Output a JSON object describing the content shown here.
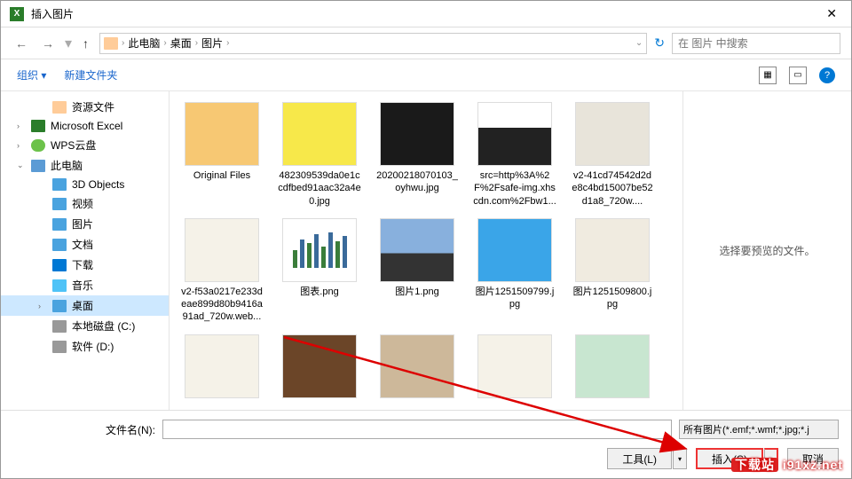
{
  "title": "插入图片",
  "nav": {
    "back": "←",
    "fwd": "→",
    "up": "↑",
    "crumbs": [
      "此电脑",
      "桌面",
      "图片"
    ],
    "refresh": "↻",
    "search_placeholder": "在 图片 中搜索"
  },
  "toolbar": {
    "organize": "组织 ▾",
    "new_folder": "新建文件夹"
  },
  "tree": [
    {
      "label": "资源文件",
      "indent": true,
      "icon": "folder"
    },
    {
      "label": "Microsoft Excel",
      "icon": "green",
      "caret": "›"
    },
    {
      "label": "WPS云盘",
      "icon": "cloud",
      "caret": "›"
    },
    {
      "label": "此电脑",
      "icon": "pc",
      "caret": "⌄"
    },
    {
      "label": "3D Objects",
      "indent": true,
      "icon": "blue"
    },
    {
      "label": "视频",
      "indent": true,
      "icon": "blue"
    },
    {
      "label": "图片",
      "indent": true,
      "icon": "blue"
    },
    {
      "label": "文档",
      "indent": true,
      "icon": "blue"
    },
    {
      "label": "下载",
      "indent": true,
      "icon": "dl"
    },
    {
      "label": "音乐",
      "indent": true,
      "icon": "music"
    },
    {
      "label": "桌面",
      "indent": true,
      "icon": "blue",
      "sel": true,
      "caret": "›"
    },
    {
      "label": "本地磁盘 (C:)",
      "indent": true,
      "icon": "disk"
    },
    {
      "label": "软件 (D:)",
      "indent": true,
      "icon": "disk"
    }
  ],
  "files": [
    {
      "name": "Original Files",
      "thumb": "folder"
    },
    {
      "name": "482309539da0e1ccdfbed91aac32a4e0.jpg",
      "thumb": "sponge"
    },
    {
      "name": "20200218070103_oyhwu.jpg",
      "thumb": "dark"
    },
    {
      "name": "src=http%3A%2F%2Fsafe-img.xhscdn.com%2Fbw1...",
      "thumb": "portrait"
    },
    {
      "name": "v2-41cd74542d2de8c4bd15007be52d1a8_720w....",
      "thumb": "photo"
    },
    {
      "name": "v2-f53a0217e233deae899d80b9416a91ad_720w.web...",
      "thumb": "bottle"
    },
    {
      "name": "图表.png",
      "thumb": "chart"
    },
    {
      "name": "图片1.png",
      "thumb": "sunset"
    },
    {
      "name": "图片1251509799.jpg",
      "thumb": "doraemon"
    },
    {
      "name": "图片1251509800.jpg",
      "thumb": "burger"
    },
    {
      "name": "",
      "thumb": "bottle"
    },
    {
      "name": "",
      "thumb": "leather"
    },
    {
      "name": "",
      "thumb": "beige"
    },
    {
      "name": "",
      "thumb": "bottle"
    },
    {
      "name": "",
      "thumb": "mint"
    }
  ],
  "preview_text": "选择要预览的文件。",
  "footer": {
    "filename_label": "文件名(N):",
    "filter": "所有图片(*.emf;*.wmf;*.jpg;*.j",
    "tools": "工具(L)",
    "insert": "插入(S)",
    "cancel": "取消"
  },
  "watermark": "i91xz.net",
  "watermark_badge": "下载站"
}
